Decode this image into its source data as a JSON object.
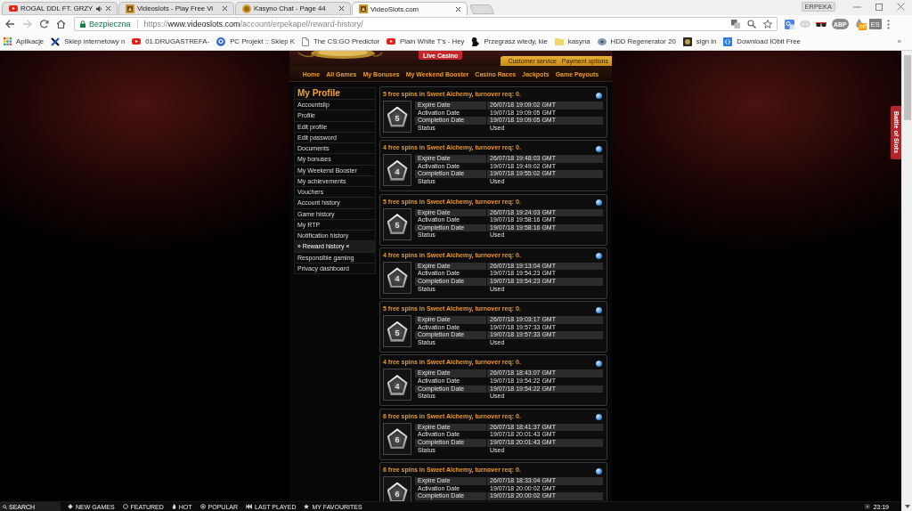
{
  "browser": {
    "tabs": [
      {
        "title": "ROGAL DDL FT. GRZY",
        "kind": "video",
        "audio": true,
        "selected": false
      },
      {
        "title": "Videoslots - Play Free Vi",
        "kind": "slots",
        "audio": false,
        "selected": false
      },
      {
        "title": "Kasyno Chat - Page 44",
        "kind": "coin",
        "audio": false,
        "selected": false
      },
      {
        "title": "VideoSlots.com",
        "kind": "slots",
        "audio": false,
        "selected": true
      }
    ],
    "profile": "ERPEKA",
    "address": {
      "security": "Bezpieczna",
      "scheme": "https://",
      "host": "www.videoslots.com",
      "path": "/account/erpekapel/reward-history/"
    },
    "extensions": [
      {
        "kind": "translate"
      },
      {
        "kind": "owl"
      },
      {
        "kind": "mask"
      },
      {
        "kind": "circle",
        "label": "ABP"
      },
      {
        "kind": "fire",
        "badge": "off"
      },
      {
        "kind": "tile",
        "label": "ES"
      }
    ],
    "bookmarks": [
      {
        "label": "Aplikacje",
        "kind": "apps"
      },
      {
        "label": "Sklep internetowy n",
        "kind": "cross"
      },
      {
        "label": "01.DRUGASTREFA-",
        "kind": "video"
      },
      {
        "label": "PC Projekt :: Sklep K",
        "kind": "pc"
      },
      {
        "label": "The CS:GO Predictor",
        "kind": "page"
      },
      {
        "label": "Plain White T's - Hey",
        "kind": "video"
      },
      {
        "label": "Przegrasz wtedy, kie",
        "kind": "figure"
      },
      {
        "label": "kasyna",
        "kind": "folder"
      },
      {
        "label": "HDD Regenerator 20",
        "kind": "disk"
      },
      {
        "label": "sign in",
        "kind": "emblem"
      },
      {
        "label": "Download IObit Free",
        "kind": "iobit"
      }
    ],
    "bookmarks_more": "»"
  },
  "site": {
    "live_casino": "Live Casino",
    "top_links": [
      "Customer service",
      "Payment options"
    ],
    "nav": [
      "Home",
      "All Games",
      "My Bonuses",
      "My Weekend Booster",
      "Casino Races",
      "Jackpots",
      "Game Payouts"
    ],
    "sidebar": {
      "title": "My Profile",
      "items": [
        {
          "label": "Accountslip",
          "selected": false
        },
        {
          "label": "Profile",
          "selected": false
        },
        {
          "label": "Edit profile",
          "selected": false
        },
        {
          "label": "Edit password",
          "selected": false
        },
        {
          "label": "Documents",
          "selected": false
        },
        {
          "label": "My bonuses",
          "selected": false
        },
        {
          "label": "My Weekend Booster",
          "selected": false
        },
        {
          "label": "My achievements",
          "selected": false
        },
        {
          "label": "Vouchers",
          "selected": false
        },
        {
          "label": "Account history",
          "selected": false
        },
        {
          "label": "Game history",
          "selected": false
        },
        {
          "label": "My RTP",
          "selected": false
        },
        {
          "label": "Notification history",
          "selected": false
        },
        {
          "label": "» Reward history «",
          "selected": true
        },
        {
          "label": "Responsible gaming",
          "selected": false
        },
        {
          "label": "Privacy dashboard",
          "selected": false
        }
      ]
    },
    "rewards": [
      {
        "title": "5 free spins in Sweet Alchemy, turnover req: 0.",
        "badge": "5",
        "details": [
          {
            "label": "Expire Date",
            "value": "26/07/18 19:09:02 GMT"
          },
          {
            "label": "Activation Date",
            "value": "19/07/18 19:09:05 GMT"
          },
          {
            "label": "Completion Date",
            "value": "19/07/18 19:09:05 GMT"
          },
          {
            "label": "Status",
            "value": "Used"
          }
        ]
      },
      {
        "title": "4 free spins in Sweet Alchemy, turnover req: 0.",
        "badge": "4",
        "details": [
          {
            "label": "Expire Date",
            "value": "26/07/18 19:48:03 GMT"
          },
          {
            "label": "Activation Date",
            "value": "19/07/18 19:49:02 GMT"
          },
          {
            "label": "Completion Date",
            "value": "19/07/18 19:55:02 GMT"
          },
          {
            "label": "Status",
            "value": "Used"
          }
        ]
      },
      {
        "title": "5 free spins in Sweet Alchemy, turnover req: 0.",
        "badge": "5",
        "details": [
          {
            "label": "Expire Date",
            "value": "26/07/18 19:24:03 GMT"
          },
          {
            "label": "Activation Date",
            "value": "19/07/18 19:58:16 GMT"
          },
          {
            "label": "Completion Date",
            "value": "19/07/18 19:58:16 GMT"
          },
          {
            "label": "Status",
            "value": "Used"
          }
        ]
      },
      {
        "title": "4 free spins in Sweet Alchemy, turnover req: 0.",
        "badge": "4",
        "details": [
          {
            "label": "Expire Date",
            "value": "26/07/18 19:13:04 GMT"
          },
          {
            "label": "Activation Date",
            "value": "19/07/18 19:54:23 GMT"
          },
          {
            "label": "Completion Date",
            "value": "19/07/18 19:54:23 GMT"
          },
          {
            "label": "Status",
            "value": "Used"
          }
        ]
      },
      {
        "title": "5 free spins in Sweet Alchemy, turnover req: 0.",
        "badge": "5",
        "details": [
          {
            "label": "Expire Date",
            "value": "26/07/18 19:03:17 GMT"
          },
          {
            "label": "Activation Date",
            "value": "19/07/18 19:57:33 GMT"
          },
          {
            "label": "Completion Date",
            "value": "19/07/18 19:57:33 GMT"
          },
          {
            "label": "Status",
            "value": "Used"
          }
        ]
      },
      {
        "title": "4 free spins in Sweet Alchemy, turnover req: 0.",
        "badge": "4",
        "details": [
          {
            "label": "Expire Date",
            "value": "26/07/18 18:43:07 GMT"
          },
          {
            "label": "Activation Date",
            "value": "19/07/18 19:54:22 GMT"
          },
          {
            "label": "Completion Date",
            "value": "19/07/18 19:54:22 GMT"
          },
          {
            "label": "Status",
            "value": "Used"
          }
        ]
      },
      {
        "title": "6 free spins in Sweet Alchemy, turnover req: 0.",
        "badge": "6",
        "details": [
          {
            "label": "Expire Date",
            "value": "26/07/18 18:41:37 GMT"
          },
          {
            "label": "Activation Date",
            "value": "19/07/18 20:01:43 GMT"
          },
          {
            "label": "Completion Date",
            "value": "19/07/18 20:01:43 GMT"
          },
          {
            "label": "Status",
            "value": "Used"
          }
        ]
      },
      {
        "title": "6 free spins in Sweet Alchemy, turnover req: 0.",
        "badge": "6",
        "details": [
          {
            "label": "Expire Date",
            "value": "26/07/18 18:33:04 GMT"
          },
          {
            "label": "Activation Date",
            "value": "19/07/18 20:00:02 GMT"
          },
          {
            "label": "Completion Date",
            "value": "19/07/18 20:00:02 GMT"
          }
        ]
      }
    ],
    "side_tab": "Battle of Slots"
  },
  "bottom_bar": {
    "search": {
      "placeholder": "SEARCH"
    },
    "items": [
      {
        "label": "NEW GAMES",
        "kind": "new"
      },
      {
        "label": "FEATURED",
        "kind": "featured"
      },
      {
        "label": "HOT",
        "kind": "hot"
      },
      {
        "label": "POPULAR",
        "kind": "popular"
      },
      {
        "label": "LAST PLAYED",
        "kind": "last"
      },
      {
        "label": "MY FAVOURITES",
        "kind": "favourites"
      }
    ],
    "clock": "23:19"
  }
}
